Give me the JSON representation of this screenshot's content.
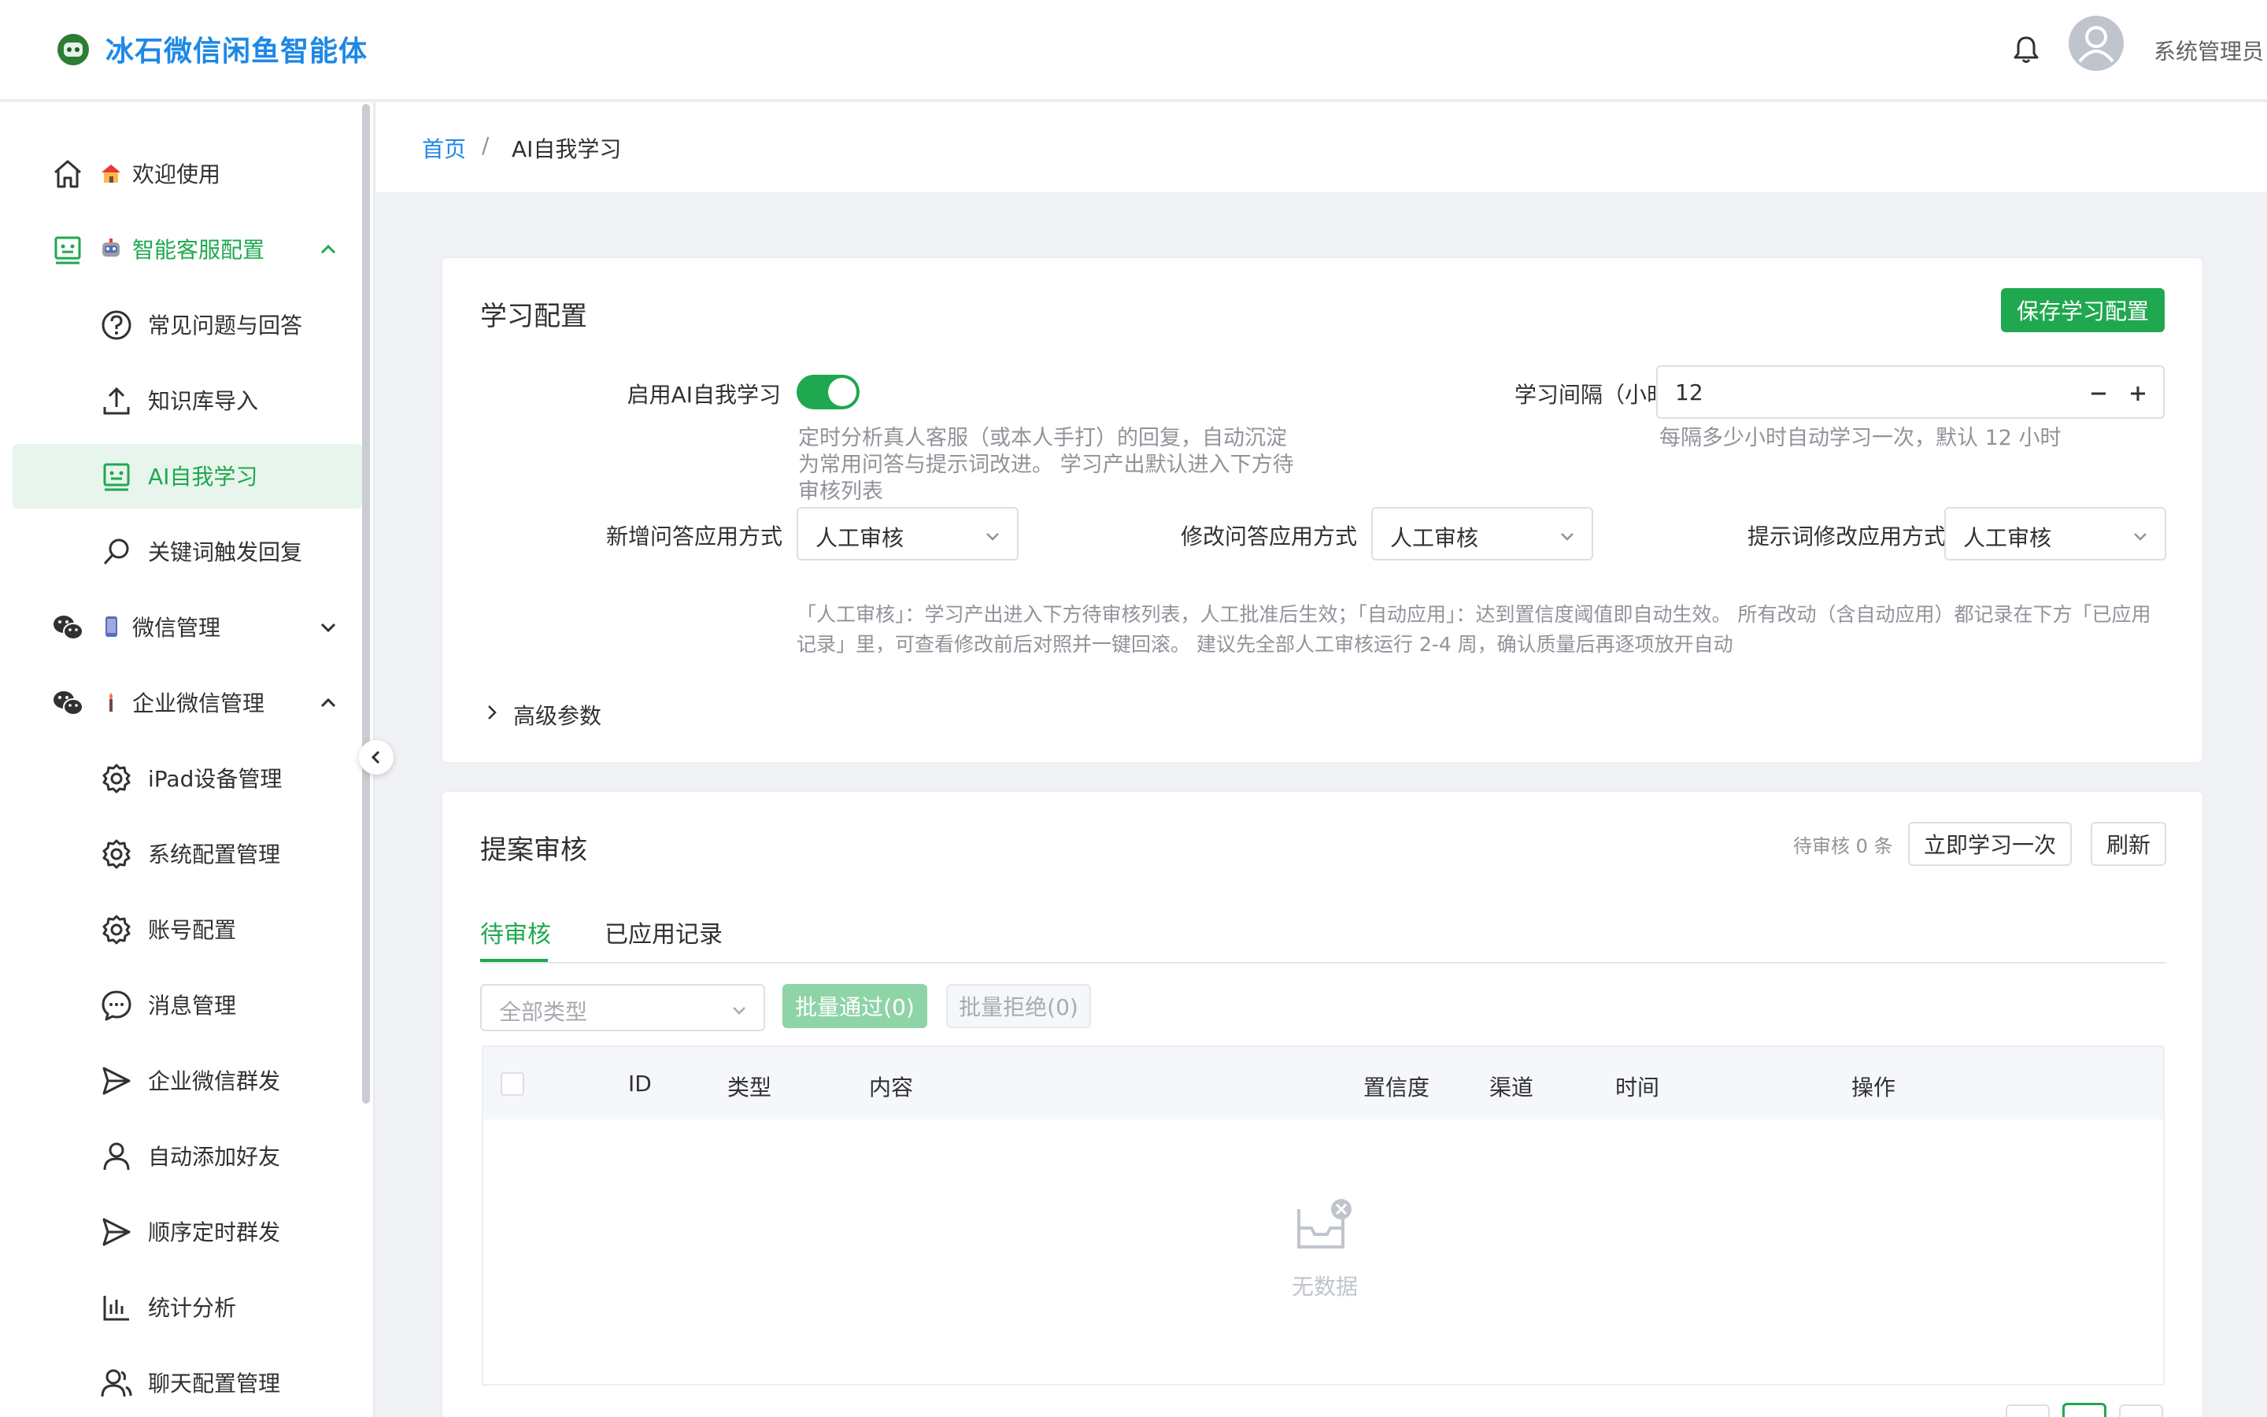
{
  "header": {
    "app_title": "冰石微信闲鱼智能体",
    "user_name": "系统管理员",
    "logo_icon": "robot-logo-icon",
    "bell_icon": "bell-icon"
  },
  "sidebar": {
    "items": [
      {
        "label": "欢迎使用",
        "icon": "home-icon",
        "emoji": "house-emoji"
      },
      {
        "label": "智能客服配置",
        "icon": "robot-face-icon",
        "emoji": "robot-emoji"
      },
      {
        "label": "常见问题与回答",
        "icon": "question-circle-icon"
      },
      {
        "label": "知识库导入",
        "icon": "upload-icon"
      },
      {
        "label": "AI自我学习",
        "icon": "robot-face-icon"
      },
      {
        "label": "关键词触发回复",
        "icon": "search-icon"
      },
      {
        "label": "微信管理",
        "icon": "wechat-icon",
        "emoji": "phone-emoji"
      },
      {
        "label": "企业微信管理",
        "icon": "wechat-icon",
        "emoji": "torch-emoji"
      },
      {
        "label": "iPad设备管理",
        "icon": "gear-icon"
      },
      {
        "label": "系统配置管理",
        "icon": "gear-icon"
      },
      {
        "label": "账号配置",
        "icon": "gear-icon"
      },
      {
        "label": "消息管理",
        "icon": "chat-bubble-icon"
      },
      {
        "label": "企业微信群发",
        "icon": "send-icon"
      },
      {
        "label": "自动添加好友",
        "icon": "user-icon"
      },
      {
        "label": "顺序定时群发",
        "icon": "send-icon"
      },
      {
        "label": "统计分析",
        "icon": "bar-chart-icon"
      },
      {
        "label": "聊天配置管理",
        "icon": "users-icon"
      }
    ]
  },
  "breadcrumb": {
    "home": "首页",
    "separator": "/",
    "current": "AI自我学习"
  },
  "learning_config": {
    "title": "学习配置",
    "save_button": "保存学习配置",
    "enable_label": "启用AI自我学习",
    "enable_value": true,
    "enable_help": "定时分析真人客服（或本人手打）的回复，自动沉淀为常用问答与提示词改进。 学习产出默认进入下方待审核列表",
    "interval_label": "学习间隔（小时）",
    "interval_value": "12",
    "interval_help": "每隔多少小时自动学习一次，默认 12 小时",
    "new_qa_label": "新增问答应用方式",
    "new_qa_value": "人工审核",
    "modify_qa_label": "修改问答应用方式",
    "modify_qa_value": "人工审核",
    "prompt_label": "提示词修改应用方式",
    "prompt_value": "人工审核",
    "note": "「人工审核」：学习产出进入下方待审核列表，人工批准后生效；「自动应用」：达到置信度阈值即自动生效。 所有改动（含自动应用）都记录在下方「已应用记录」里，可查看修改前后对照并一键回滚。 建议先全部人工审核运行 2-4 周，确认质量后再逐项放开自动",
    "advanced": "高级参数"
  },
  "proposal_review": {
    "title": "提案审核",
    "pending_count": "待审核 0 条",
    "learn_now_button": "立即学习一次",
    "refresh_button": "刷新",
    "tabs": [
      "待审核",
      "已应用记录"
    ],
    "active_tab": 0,
    "type_filter_placeholder": "全部类型",
    "batch_approve": "批量通过(0)",
    "batch_reject": "批量拒绝(0)",
    "columns": [
      "ID",
      "类型",
      "内容",
      "置信度",
      "渠道",
      "时间",
      "操作"
    ],
    "rows": [],
    "empty_text": "无数据"
  },
  "colors": {
    "primary": "#1fa84f",
    "link": "#1e88e5",
    "active_bg": "#e8f5ec"
  }
}
